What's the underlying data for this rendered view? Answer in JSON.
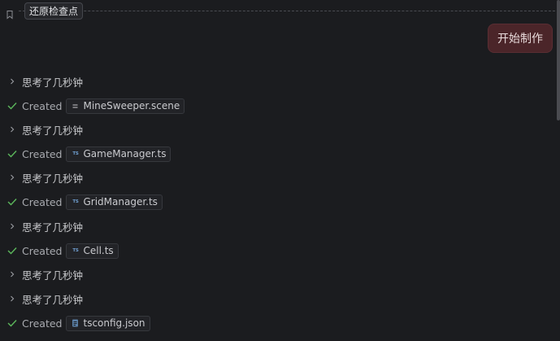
{
  "checkpoint": {
    "restore_label": "还原检查点"
  },
  "user_message": {
    "text": "开始制作"
  },
  "activity": {
    "thinking_text": "思考了几秒钟",
    "created_text": "Created",
    "files": [
      {
        "name": "MineSweeper.scene",
        "icon": "scene-file-icon"
      },
      {
        "name": "GameManager.ts",
        "icon": "typescript-file-icon"
      },
      {
        "name": "GridManager.ts",
        "icon": "typescript-file-icon"
      },
      {
        "name": "Cell.ts",
        "icon": "typescript-file-icon"
      },
      {
        "name": "tsconfig.json",
        "icon": "json-file-icon"
      }
    ]
  },
  "colors": {
    "background": "#1b1c1f",
    "user_bubble": "#4b2529",
    "check_green": "#5cb85c",
    "ts_blue": "#6f9fd0"
  }
}
